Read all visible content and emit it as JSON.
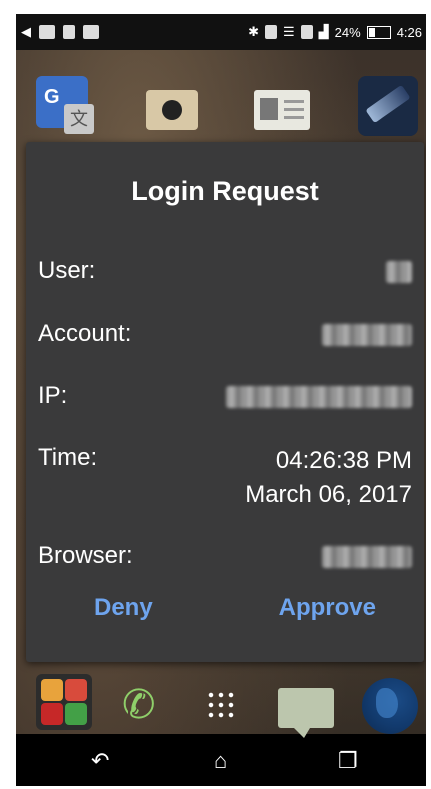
{
  "status_bar": {
    "battery_percent": "24%",
    "time": "4:26",
    "icons": [
      "back-arrow-icon",
      "app-notification-icon",
      "photo-icon",
      "tablet-icon",
      "bluetooth-icon",
      "nfc-icon",
      "wifi-icon",
      "data-icon",
      "signal-icon",
      "battery-icon"
    ]
  },
  "dialog": {
    "title": "Login Request",
    "rows": [
      {
        "label": "User:",
        "value_obscured": true
      },
      {
        "label": "Account:",
        "value_obscured": true
      },
      {
        "label": "IP:",
        "value_obscured": true
      },
      {
        "label": "Time:",
        "value_line1": "04:26:38 PM",
        "value_line2": "March 06, 2017"
      },
      {
        "label": "Browser:",
        "value_obscured": true
      }
    ],
    "deny_label": "Deny",
    "approve_label": "Approve",
    "accent_color": "#6ea4ee",
    "background_color": "#3a3a3b"
  },
  "home_apps_top": [
    "translate-app-icon",
    "camera-app-icon",
    "contacts-app-icon",
    "flashlight-app-icon"
  ],
  "dock": [
    "google-folder-icon",
    "phone-icon",
    "app-drawer-icon",
    "messages-icon",
    "browser-globe-icon"
  ],
  "nav_bar": {
    "back_glyph": "↶",
    "home_glyph": "⌂",
    "recent_glyph": "❐"
  }
}
